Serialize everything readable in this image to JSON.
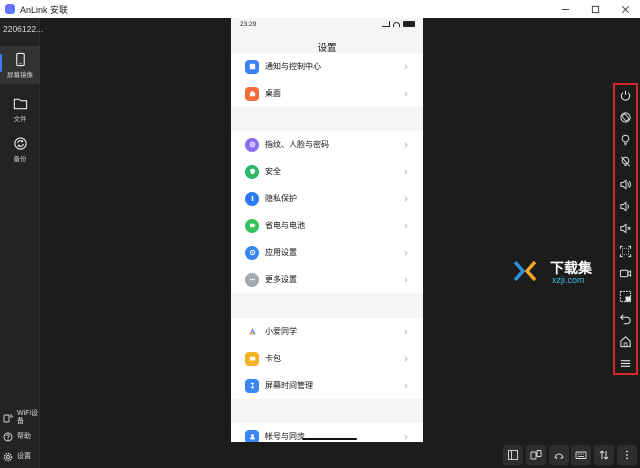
{
  "window": {
    "title": "AnLink 安联",
    "controls": [
      "minimize-icon",
      "maximize-icon",
      "close-icon"
    ]
  },
  "sidebar": {
    "device_id": "2206122...",
    "items": [
      {
        "label": "屏幕镜像",
        "icon": "phone-icon",
        "active": true
      },
      {
        "label": "文件",
        "icon": "folder-icon",
        "active": false
      },
      {
        "label": "备份",
        "icon": "sync-icon",
        "active": false
      }
    ],
    "bottom": [
      {
        "label": "WiFi设备",
        "icon": "wifi-device-icon"
      },
      {
        "label": "帮助",
        "icon": "help-icon"
      },
      {
        "label": "设置",
        "icon": "gear-icon"
      }
    ],
    "accent_color": "#3b7cff"
  },
  "phone": {
    "status": {
      "time": "23:29",
      "battery": "100"
    },
    "title": "设置",
    "groups": [
      [
        {
          "label": "通知与控制中心",
          "icon": "notification-icon",
          "color": "#3c82f6"
        },
        {
          "label": "桌面",
          "icon": "home-icon",
          "color": "#f26c3a"
        }
      ],
      [
        {
          "label": "指纹、人脸与密码",
          "icon": "fingerprint-icon",
          "color": "#8c6cf0"
        },
        {
          "label": "安全",
          "icon": "shield-icon",
          "color": "#2fb86a"
        },
        {
          "label": "隐私保护",
          "icon": "privacy-icon",
          "color": "#2d7bf2"
        },
        {
          "label": "省电与电池",
          "icon": "battery-icon",
          "color": "#35c25f"
        },
        {
          "label": "应用设置",
          "icon": "app-gear-icon",
          "color": "#3a86f4"
        },
        {
          "label": "更多设置",
          "icon": "more-icon",
          "color": "#a5a9b2"
        }
      ],
      [
        {
          "label": "小爱同学",
          "icon": "xiaoai-icon",
          "color": "#ffffff"
        },
        {
          "label": "卡包",
          "icon": "wallet-icon",
          "color": "#f5b224"
        },
        {
          "label": "屏幕时间管理",
          "icon": "hourglass-icon",
          "color": "#3a86f4"
        }
      ],
      [
        {
          "label": "帐号与同步",
          "icon": "account-icon",
          "color": "#3a86f4"
        }
      ]
    ]
  },
  "right_toolbar": {
    "border_color": "#d8262d",
    "buttons": [
      "power-icon",
      "rotate-icon",
      "light-on-icon",
      "light-off-icon",
      "volume-up-icon",
      "volume-down-icon",
      "mute-icon",
      "screenshot-icon",
      "record-icon",
      "crop-icon",
      "back-icon",
      "home-icon",
      "menu-icon"
    ]
  },
  "watermark": {
    "text": "下载集",
    "domain": "xzji.com"
  },
  "bottom_toolbar": {
    "buttons": [
      "layout-icon",
      "transfer-icon",
      "cast-icon",
      "keyboard-icon",
      "sort-icon",
      "more-vertical-icon"
    ]
  }
}
